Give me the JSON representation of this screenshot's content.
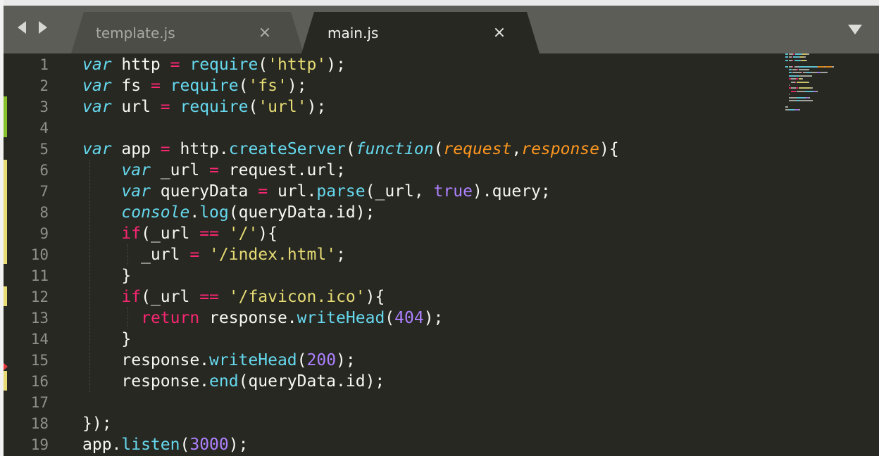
{
  "window": {
    "background": "#272822",
    "tabbar_background": "#5d5d57"
  },
  "tabs": [
    {
      "label": "template.js",
      "active": false
    },
    {
      "label": "main.js",
      "active": true
    }
  ],
  "gutter": {
    "line_numbers": [
      "1",
      "2",
      "3",
      "4",
      "5",
      "6",
      "7",
      "8",
      "9",
      "10",
      "11",
      "12",
      "13",
      "14",
      "15",
      "16",
      "17",
      "18",
      "19"
    ],
    "marks": [
      {
        "type": "added",
        "color": "#86c02b",
        "lines": [
          3,
          4
        ]
      },
      {
        "type": "modified",
        "color": "#e6db74",
        "lines": [
          6,
          7,
          8,
          9,
          10
        ]
      },
      {
        "type": "modified",
        "color": "#e6db74",
        "lines": [
          12
        ]
      },
      {
        "type": "modified",
        "color": "#e6db74",
        "lines": [
          16
        ]
      }
    ],
    "bookmark_line": 15
  },
  "code": {
    "lines": [
      [
        [
          "kw-italic",
          "var"
        ],
        [
          "plain",
          " http "
        ],
        [
          "op",
          "="
        ],
        [
          "plain",
          " "
        ],
        [
          "fn",
          "require"
        ],
        [
          "plain",
          "("
        ],
        [
          "str",
          "'http'"
        ],
        [
          "plain",
          ");"
        ]
      ],
      [
        [
          "kw-italic",
          "var"
        ],
        [
          "plain",
          " fs "
        ],
        [
          "op",
          "="
        ],
        [
          "plain",
          " "
        ],
        [
          "fn",
          "require"
        ],
        [
          "plain",
          "("
        ],
        [
          "str",
          "'fs'"
        ],
        [
          "plain",
          ");"
        ]
      ],
      [
        [
          "kw-italic",
          "var"
        ],
        [
          "plain",
          " url "
        ],
        [
          "op",
          "="
        ],
        [
          "plain",
          " "
        ],
        [
          "fn",
          "require"
        ],
        [
          "plain",
          "("
        ],
        [
          "str",
          "'url'"
        ],
        [
          "plain",
          ");"
        ]
      ],
      [],
      [
        [
          "kw-italic",
          "var"
        ],
        [
          "plain",
          " app "
        ],
        [
          "op",
          "="
        ],
        [
          "plain",
          " http."
        ],
        [
          "fn",
          "createServer"
        ],
        [
          "plain",
          "("
        ],
        [
          "kw-italic",
          "function"
        ],
        [
          "plain",
          "("
        ],
        [
          "param",
          "request"
        ],
        [
          "plain",
          ","
        ],
        [
          "param",
          "response"
        ],
        [
          "plain",
          "){"
        ]
      ],
      [
        [
          "plain",
          "    "
        ],
        [
          "kw-italic",
          "var"
        ],
        [
          "plain",
          " _url "
        ],
        [
          "op",
          "="
        ],
        [
          "plain",
          " request.url;"
        ]
      ],
      [
        [
          "plain",
          "    "
        ],
        [
          "kw-italic",
          "var"
        ],
        [
          "plain",
          " queryData "
        ],
        [
          "op",
          "="
        ],
        [
          "plain",
          " url."
        ],
        [
          "fn",
          "parse"
        ],
        [
          "plain",
          "(_url, "
        ],
        [
          "num",
          "true"
        ],
        [
          "plain",
          ").query;"
        ]
      ],
      [
        [
          "plain",
          "    "
        ],
        [
          "kw-italic",
          "console"
        ],
        [
          "plain",
          "."
        ],
        [
          "fn",
          "log"
        ],
        [
          "plain",
          "(queryData.id);"
        ]
      ],
      [
        [
          "plain",
          "    "
        ],
        [
          "kw",
          "if"
        ],
        [
          "plain",
          "(_url "
        ],
        [
          "op",
          "=="
        ],
        [
          "plain",
          " "
        ],
        [
          "str",
          "'/'"
        ],
        [
          "plain",
          "){"
        ]
      ],
      [
        [
          "plain",
          "      _url "
        ],
        [
          "op",
          "="
        ],
        [
          "plain",
          " "
        ],
        [
          "str",
          "'/index.html'"
        ],
        [
          "plain",
          ";"
        ]
      ],
      [
        [
          "plain",
          "    }"
        ]
      ],
      [
        [
          "plain",
          "    "
        ],
        [
          "kw",
          "if"
        ],
        [
          "plain",
          "(_url "
        ],
        [
          "op",
          "=="
        ],
        [
          "plain",
          " "
        ],
        [
          "str",
          "'/favicon.ico'"
        ],
        [
          "plain",
          "){"
        ]
      ],
      [
        [
          "plain",
          "      "
        ],
        [
          "kw",
          "return"
        ],
        [
          "plain",
          " response."
        ],
        [
          "fn",
          "writeHead"
        ],
        [
          "plain",
          "("
        ],
        [
          "num",
          "404"
        ],
        [
          "plain",
          ");"
        ]
      ],
      [
        [
          "plain",
          "    }"
        ]
      ],
      [
        [
          "plain",
          "    response."
        ],
        [
          "fn",
          "writeHead"
        ],
        [
          "plain",
          "("
        ],
        [
          "num",
          "200"
        ],
        [
          "plain",
          ");"
        ]
      ],
      [
        [
          "plain",
          "    response."
        ],
        [
          "fn",
          "end"
        ],
        [
          "plain",
          "(queryData.id);"
        ]
      ],
      [],
      [
        [
          "plain",
          "});"
        ]
      ],
      [
        [
          "plain",
          "app."
        ],
        [
          "fn",
          "listen"
        ],
        [
          "plain",
          "("
        ],
        [
          "num",
          "3000"
        ],
        [
          "plain",
          ");"
        ]
      ]
    ]
  },
  "colors": {
    "keyword": "#f92672",
    "storage": "#66d9ef",
    "function": "#66d9ef",
    "string": "#e6db74",
    "number": "#ae81ff",
    "parameter": "#fd971f",
    "text": "#f8f8f2",
    "line_number": "#8f908a"
  },
  "icons": {
    "nav_back": "triangle-left-icon",
    "nav_forward": "triangle-right-icon",
    "tab_close": "close-icon",
    "tab_dropdown": "chevron-down-icon",
    "bookmark": "bookmark-icon"
  }
}
